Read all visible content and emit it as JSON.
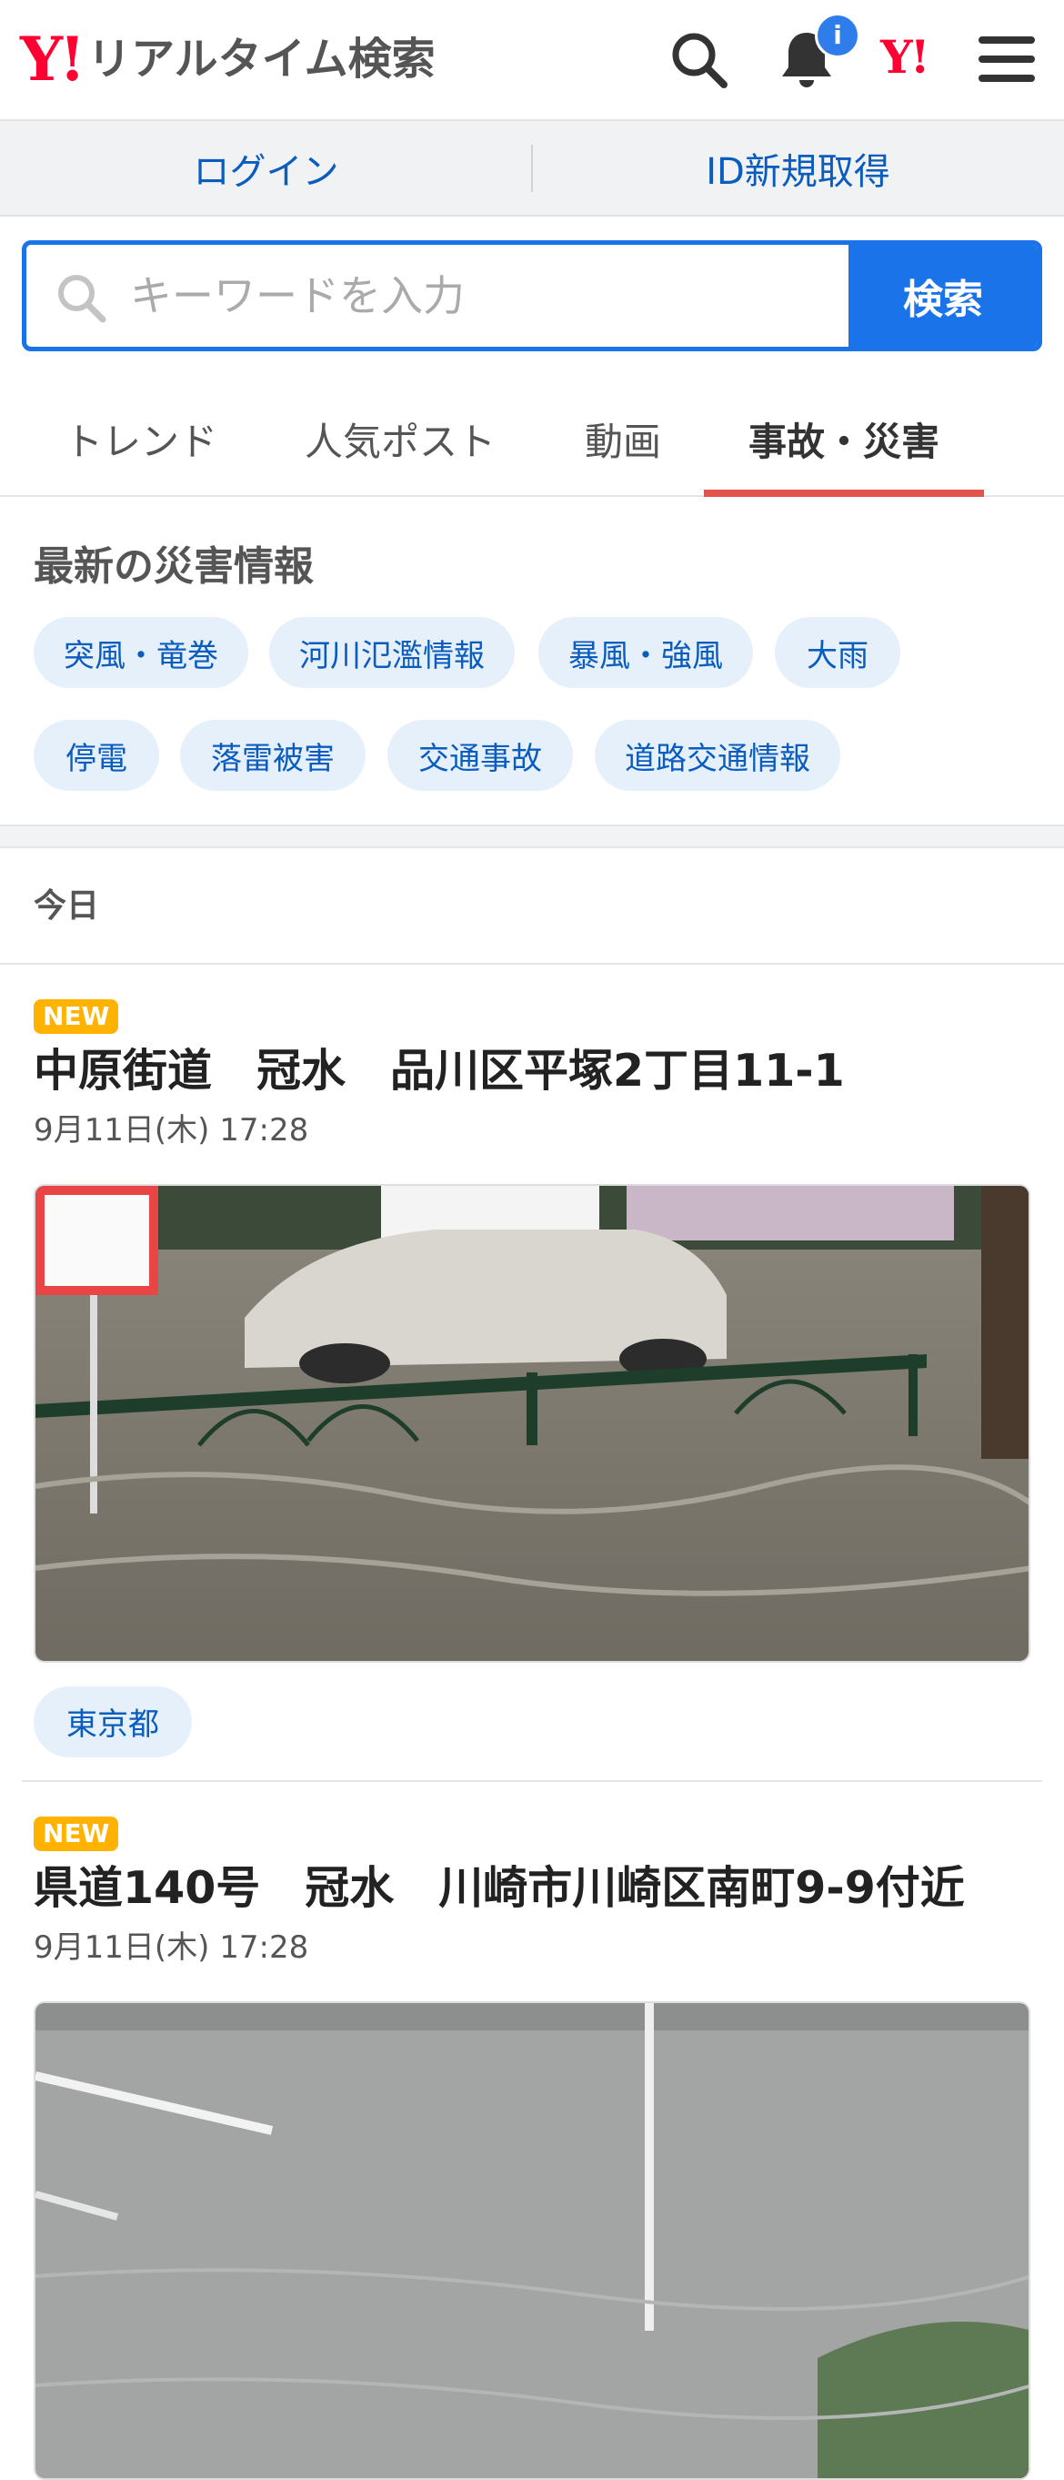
{
  "header": {
    "logo_mark": "Y!",
    "logo_text": "リアルタイム検索",
    "notification_badge": "i",
    "yahoo_mark": "Y!",
    "icons": [
      "search-icon",
      "bell-icon",
      "yahoo-logo",
      "menu-icon"
    ],
    "brand_color": "#ff0033"
  },
  "login_bar": {
    "login": "ログイン",
    "register": "ID新規取得"
  },
  "search": {
    "placeholder": "キーワードを入力",
    "button": "検索",
    "accent_color": "#1a73e8"
  },
  "tabs": [
    {
      "label": "トレンド",
      "active": false
    },
    {
      "label": "人気ポスト",
      "active": false
    },
    {
      "label": "動画",
      "active": false
    },
    {
      "label": "事故・災害",
      "active": true
    }
  ],
  "disaster": {
    "title": "最新の災害情報",
    "chips": [
      "突風・竜巻",
      "河川氾濫情報",
      "暴風・強風",
      "大雨",
      "停電",
      "落雷被害",
      "交通事故",
      "道路交通情報"
    ]
  },
  "feed": {
    "day_label": "今日",
    "posts": [
      {
        "badge": "NEW",
        "title": "中原街道　冠水　品川区平塚2丁目11-1",
        "date": "9月11日(木) 17:28",
        "image": "flooded-street-photo",
        "location": "東京都"
      },
      {
        "badge": "NEW",
        "title": "県道140号　冠水　川崎市川崎区南町9-9付近",
        "date": "9月11日(木) 17:28",
        "image": "flooded-road-photo"
      }
    ]
  }
}
